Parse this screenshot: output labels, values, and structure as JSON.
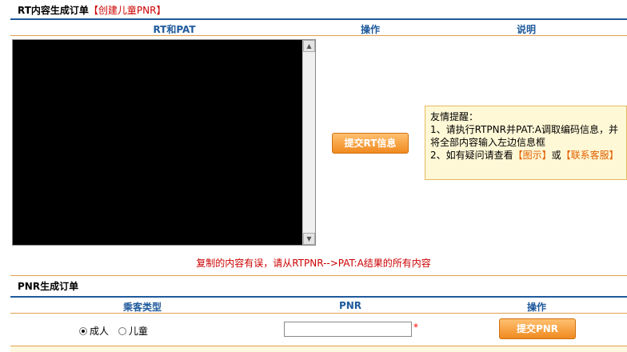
{
  "rt_section": {
    "title": "RT内容生成订单",
    "create_child_link": "【创建儿童PNR】",
    "columns": [
      "RT和PAT",
      "操作",
      "说明"
    ],
    "rt_textarea_value": "",
    "submit_rt_button": "提交RT信息",
    "tip": {
      "title": "友情提醒：",
      "line1": "1、请执行RTPNR并PAT:A调取编码信息，并将全部内容输入左边信息框",
      "line2_prefix": "2、如有疑问请查看",
      "diagram_link": "【图示】",
      "or_text": "或",
      "contact_link": "【联系客服】"
    },
    "warning": "复制的内容有误，请从RTPNR-->PAT:A结果的所有内容"
  },
  "pnr_section": {
    "title": "PNR生成订单",
    "columns": [
      "乘客类型",
      "PNR",
      "操作"
    ],
    "passenger_types": [
      {
        "label": "成人",
        "selected": true
      },
      {
        "label": "儿童",
        "selected": false
      }
    ],
    "pnr_value": "",
    "required_mark": "*",
    "submit_pnr_button": "提交PNR"
  },
  "colors": {
    "header_blue": "#1f5a9c",
    "accent_orange": "#f08a20",
    "warning_red": "#cc0000"
  }
}
